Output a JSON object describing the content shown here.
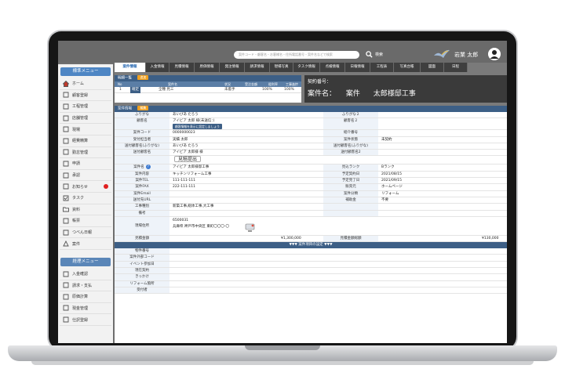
{
  "search": {
    "placeholder": "案件コード・顧客名・お客様名・住所電話番号・案件名などで検索",
    "button_label": "検索"
  },
  "user": {
    "name": "岩業 太郎"
  },
  "left_menu": {
    "header": "標準メニュー",
    "items": [
      {
        "label": "ホーム",
        "icon": "home-icon"
      },
      {
        "label": "顧客登録",
        "icon": "customer-icon"
      },
      {
        "label": "工程管理",
        "icon": "process-icon"
      },
      {
        "label": "店舗管理",
        "icon": "store-icon"
      },
      {
        "label": "現場",
        "icon": "site-icon"
      },
      {
        "label": "経費精算",
        "icon": "expense-icon"
      },
      {
        "label": "勤怠管理",
        "icon": "attendance-icon"
      },
      {
        "label": "申請",
        "icon": "apply-icon"
      },
      {
        "label": "承認",
        "icon": "approve-icon"
      },
      {
        "label": "お知らせ",
        "icon": "notice-icon",
        "badge": true
      },
      {
        "label": "タスク",
        "icon": "task-icon"
      },
      {
        "label": "資料",
        "icon": "folder-icon"
      },
      {
        "label": "帳票",
        "icon": "form-icon"
      },
      {
        "label": "つべん日報",
        "icon": "report-icon"
      },
      {
        "label": "案件",
        "icon": "project-icon"
      }
    ],
    "header2": "経理メニュー",
    "items2": [
      {
        "label": "入金確認",
        "icon": "deposit-icon"
      },
      {
        "label": "請求・支払",
        "icon": "billing-icon"
      },
      {
        "label": "原価計算",
        "icon": "cost-icon"
      },
      {
        "label": "現金管理",
        "icon": "cash-icon"
      },
      {
        "label": "仕訳登録",
        "icon": "journal-icon"
      }
    ]
  },
  "tabs": [
    "案件情報",
    "入金情報",
    "見積情報",
    "原価情報",
    "発注情報",
    "請求情報",
    "現場写真",
    "タスク情報",
    "点検情報",
    "日報情報",
    "工程表",
    "写真台帳",
    "図面",
    "日程"
  ],
  "list_panel": {
    "title": "明細一覧",
    "tag": "追加",
    "columns": [
      "No",
      "",
      "案件名",
      "状況",
      "受注金額",
      "粗利率",
      "工事進捗"
    ],
    "rows": [
      {
        "no": "1",
        "tag": "確定",
        "name": "全種 見三",
        "status": "未着手",
        "rate": "100%",
        "progress": "100%"
      }
    ]
  },
  "header_box": {
    "contract_no_label": "契約番号：",
    "name_label": "案件名：",
    "name_type": "案件",
    "name_value": "太郎様邸工事"
  },
  "detail": {
    "title": "案件情報",
    "tag": "編集",
    "rows": [
      {
        "l_label": "ふりがな",
        "l_value": "あいびあ たろう",
        "r_label": "ふりがな２",
        "r_value": ""
      },
      {
        "l_label": "顧客名",
        "l_value": "アイビア 太郎 様(未送信：)",
        "r_label": "顧客名２",
        "r_value": "",
        "button": "顧客情報を表示に設定しましょう"
      },
      {
        "l_label": "案件コード",
        "l_value": "0000000023",
        "r_label": "紹介番号",
        "r_value": ""
      },
      {
        "l_label": "受付担当者",
        "l_value": "実績 太郎",
        "r_label": "案件状態",
        "r_value": "未契約"
      },
      {
        "l_label": "送付顧客名(ふりがな)",
        "l_value": "あいびあ たろう",
        "r_label": "送付顧客名(ふりがな)",
        "r_value": ""
      },
      {
        "l_label": "送付顧客名",
        "l_value": "アイビア 太郎様 様",
        "r_label": "送付顧客名2",
        "r_value": ""
      }
    ],
    "estimate_button": "見積提出",
    "case_label": "案件名",
    "case_value": "アイビア 太郎様邸工事",
    "rank_label": "見込ランク",
    "rank_value": "Bランク",
    "rows2": [
      {
        "l_label": "案件内容",
        "l_value": "キッチンリフォーム工事",
        "r_label": "予定契約日",
        "r_value": "2021/08/15"
      },
      {
        "l_label": "案件TEL",
        "l_value": "111-111-111",
        "r_label": "予定完了日",
        "r_value": "2021/09/15"
      },
      {
        "l_label": "案件FAX",
        "l_value": "222-111-111",
        "r_label": "販売元",
        "r_value": "ホームページ"
      },
      {
        "l_label": "案件Email",
        "l_value": "",
        "r_label": "案件分類",
        "r_value": "リフォーム"
      },
      {
        "l_label": "送付先URL",
        "l_value": "",
        "r_label": "補助金",
        "r_value": "不要"
      },
      {
        "l_label": "工事種別",
        "l_value": "新築工事,総体工事,大工事",
        "r_label": "",
        "r_value": ""
      },
      {
        "l_label": "備考",
        "l_value": "",
        "r_label": "",
        "r_value": ""
      }
    ],
    "address_label": "現場住所",
    "zip": "6500031",
    "address": "兵庫県 神戸市中央区 東町〇〇〇-〇",
    "amount_label": "見積金額",
    "amount_value": "¥1,300,000",
    "amount2_label": "見積金額総額",
    "amount2_value": "¥130,000",
    "sep_label": "▼▼▼ 案件項目の設定 ▼▼▼",
    "extra_rows": [
      "物件番号",
      "案件外部コード",
      "イベント参加日",
      "現在契約",
      "きっかけ",
      "リフォーム箇所",
      "受付者"
    ]
  }
}
